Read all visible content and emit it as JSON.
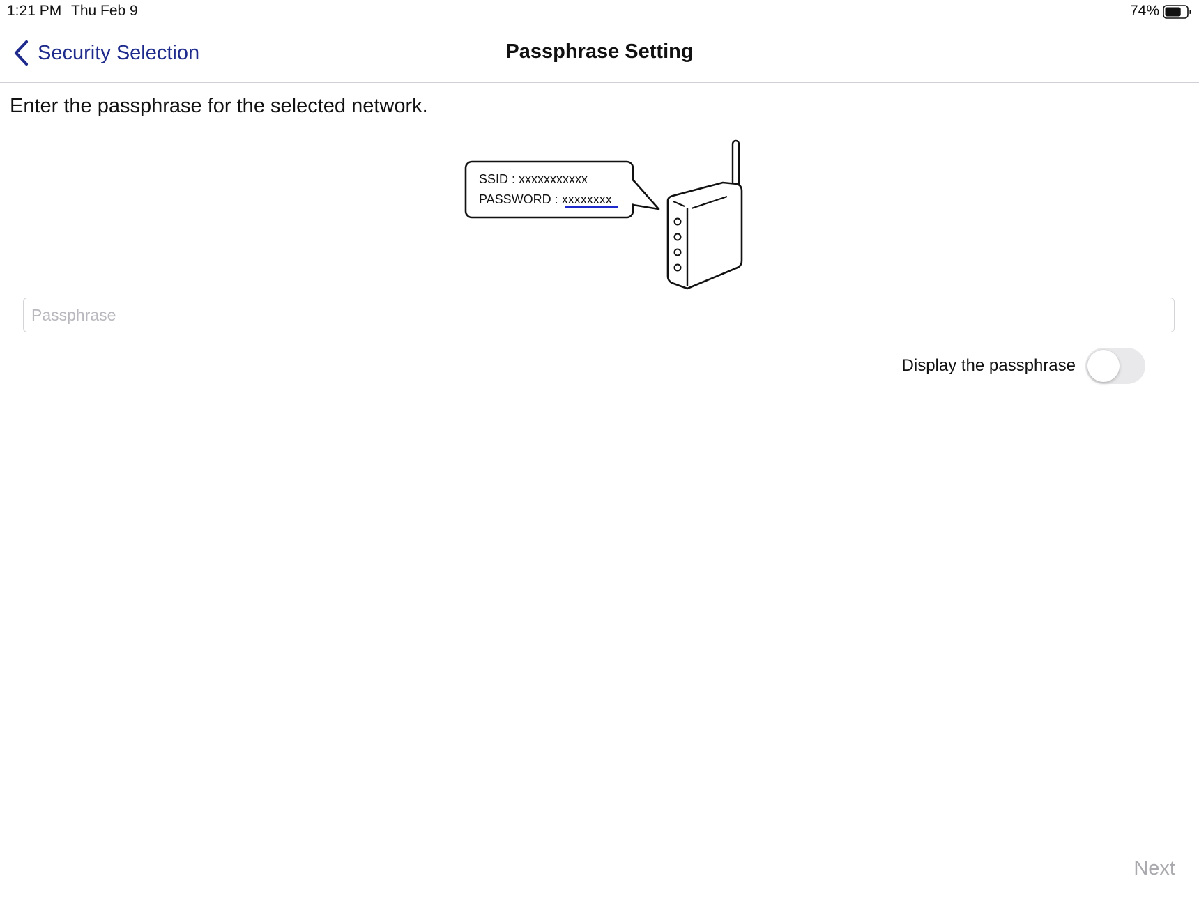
{
  "status_bar": {
    "time": "1:21 PM",
    "date": "Thu Feb 9",
    "battery_percent": "74%",
    "battery_level": 0.74,
    "battery_icon": "battery-icon"
  },
  "nav": {
    "back_label": "Security Selection",
    "back_icon": "chevron-left-icon",
    "title": "Passphrase Setting",
    "accent_color": "#1e2a8c"
  },
  "main": {
    "instruction": "Enter the passphrase for the selected network.",
    "illustration": {
      "icon": "wireless-router-icon",
      "ssid_line_label": "SSID : ",
      "ssid_value": "xxxxxxxxxxx",
      "password_line_label": "PASSWORD : ",
      "password_value": "xxxxxxxx"
    },
    "passphrase_input": {
      "placeholder": "Passphrase",
      "value": ""
    },
    "display_toggle": {
      "label": "Display the passphrase",
      "on": false
    }
  },
  "toolbar": {
    "next_label": "Next",
    "next_enabled": false
  }
}
